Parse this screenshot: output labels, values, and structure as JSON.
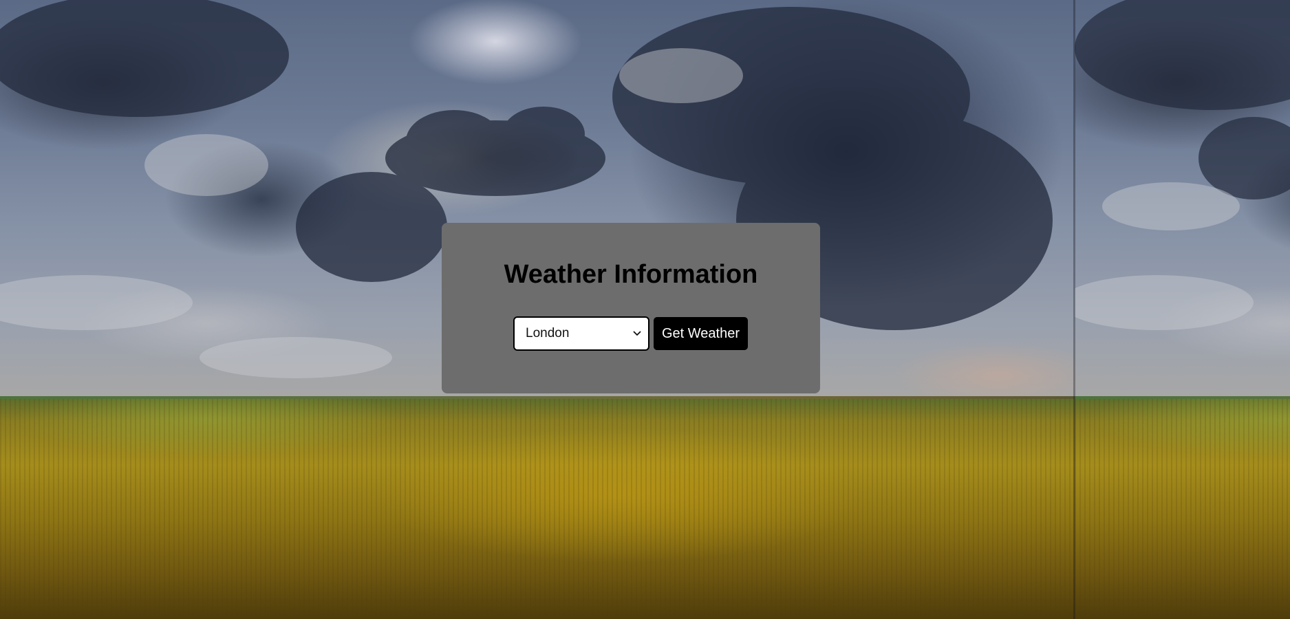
{
  "weather_card": {
    "title": "Weather Information",
    "city_select": {
      "selected": "London",
      "icon": "chevron-down-icon"
    },
    "get_weather_label": "Get Weather"
  },
  "colors": {
    "card_background": "#6d6d6d",
    "button_background": "#000000",
    "button_text": "#ffffff",
    "title_text": "#000000"
  }
}
